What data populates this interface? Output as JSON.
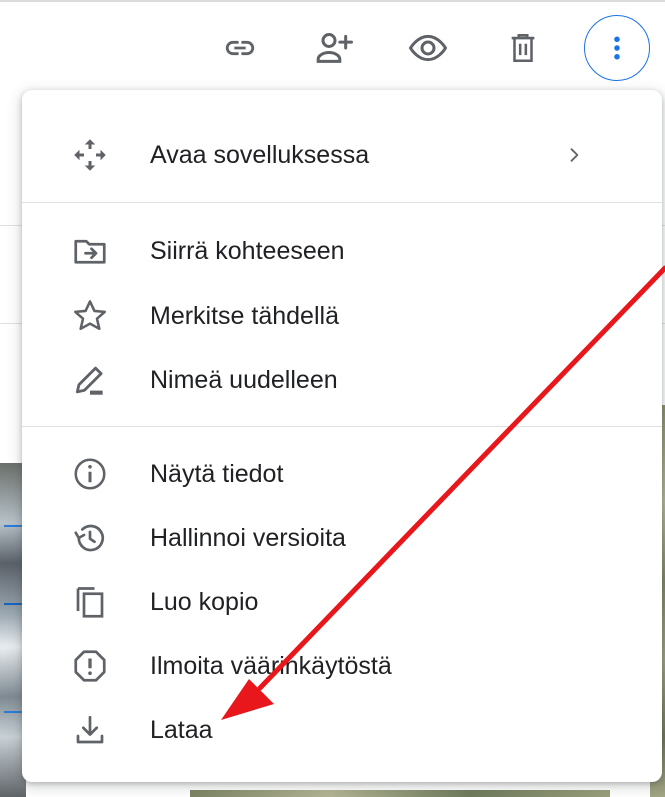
{
  "toolbar": {
    "buttons": [
      {
        "icon": "link-icon"
      },
      {
        "icon": "add-person-icon"
      },
      {
        "icon": "eye-icon"
      },
      {
        "icon": "trash-icon"
      },
      {
        "icon": "more-vert-icon"
      }
    ],
    "accent_color": "#1a73e8"
  },
  "menu": {
    "items": [
      {
        "label": "Avaa sovelluksessa",
        "icon": "open-with-icon",
        "has_submenu": true
      },
      {
        "label": "Siirrä kohteeseen",
        "icon": "move-to-folder-icon"
      },
      {
        "label": "Merkitse tähdellä",
        "icon": "star-icon"
      },
      {
        "label": "Nimeä uudelleen",
        "icon": "rename-pencil-icon"
      },
      {
        "label": "Näytä tiedot",
        "icon": "info-icon"
      },
      {
        "label": "Hallinnoi versioita",
        "icon": "history-icon"
      },
      {
        "label": "Luo kopio",
        "icon": "copy-icon"
      },
      {
        "label": "Ilmoita väärinkäytöstä",
        "icon": "report-icon"
      },
      {
        "label": "Lataa",
        "icon": "download-icon"
      }
    ]
  },
  "annotation": {
    "color": "#e8171b",
    "points_to": "Lataa"
  }
}
